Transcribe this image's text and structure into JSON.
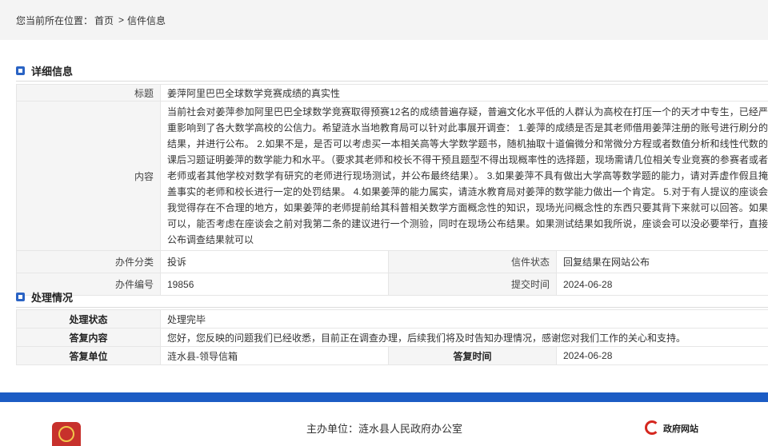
{
  "breadcrumb": {
    "prefix": "您当前所在位置：",
    "home": "首页",
    "sep": ">",
    "current": "信件信息"
  },
  "detail": {
    "title": "详细信息",
    "labels": {
      "subject": "标题",
      "content": "内容",
      "category": "办件分类",
      "status": "信件状态",
      "number": "办件编号",
      "submit_time": "提交时间"
    },
    "subject": "姜萍阿里巴巴全球数学竞赛成绩的真实性",
    "content": "当前社会对姜萍参加阿里巴巴全球数学竞赛取得预赛12名的成绩普遍存疑，普遍文化水平低的人群认为高校在打压一个的天才中专生，已经严重影响到了各大数学高校的公信力。希望涟水当地教育局可以针对此事展开调查： 1.姜萍的成绩是否是其老师借用姜萍注册的账号进行刷分的结果，并进行公布。 2.如果不是，是否可以考虑买一本相关高等大学数学题书，随机抽取十道偏微分和常微分方程或者数值分析和线性代数的课后习题证明姜萍的数学能力和水平。（要求其老师和校长不得干预且题型不得出现概率性的选择题，现场需请几位相关专业竞赛的参赛者或者老师或者其他学校对数学有研究的老师进行现场测试，并公布最终结果）。 3.如果姜萍不具有做出大学高等数学题的能力，请对弄虚作假且掩盖事实的老师和校长进行一定的处罚结果。 4.如果姜萍的能力属实，请涟水教育局对姜萍的数学能力做出一个肯定。 5.对于有人提议的座谈会我觉得存在不合理的地方，如果姜萍的老师提前给其科普相关数学方面概念性的知识，现场光问概念性的东西只要其背下来就可以回答。如果可以，能否考虑在座谈会之前对我第二条的建议进行一个测验，同时在现场公布结果。如果测试结果如我所说，座谈会可以没必要举行，直接公布调查结果就可以",
    "category": "投诉",
    "status": "回复结果在网站公布",
    "number": "19856",
    "submit_time": "2024-06-28"
  },
  "process": {
    "title": "处理情况",
    "labels": {
      "state": "处理状态",
      "reply": "答复内容",
      "unit": "答复单位",
      "reply_time": "答复时间"
    },
    "state": "处理完毕",
    "reply": "您好，您反映的问题我们已经收悉，目前正在调查办理，后续我们将及时告知办理情况，感谢您对我们工作的关心和支持。",
    "unit": "涟水县-领导信箱",
    "reply_time": "2024-06-28"
  },
  "footer": {
    "host": "主办单位：涟水县人民政府办公室",
    "gov_logo_text": "政府网站"
  }
}
